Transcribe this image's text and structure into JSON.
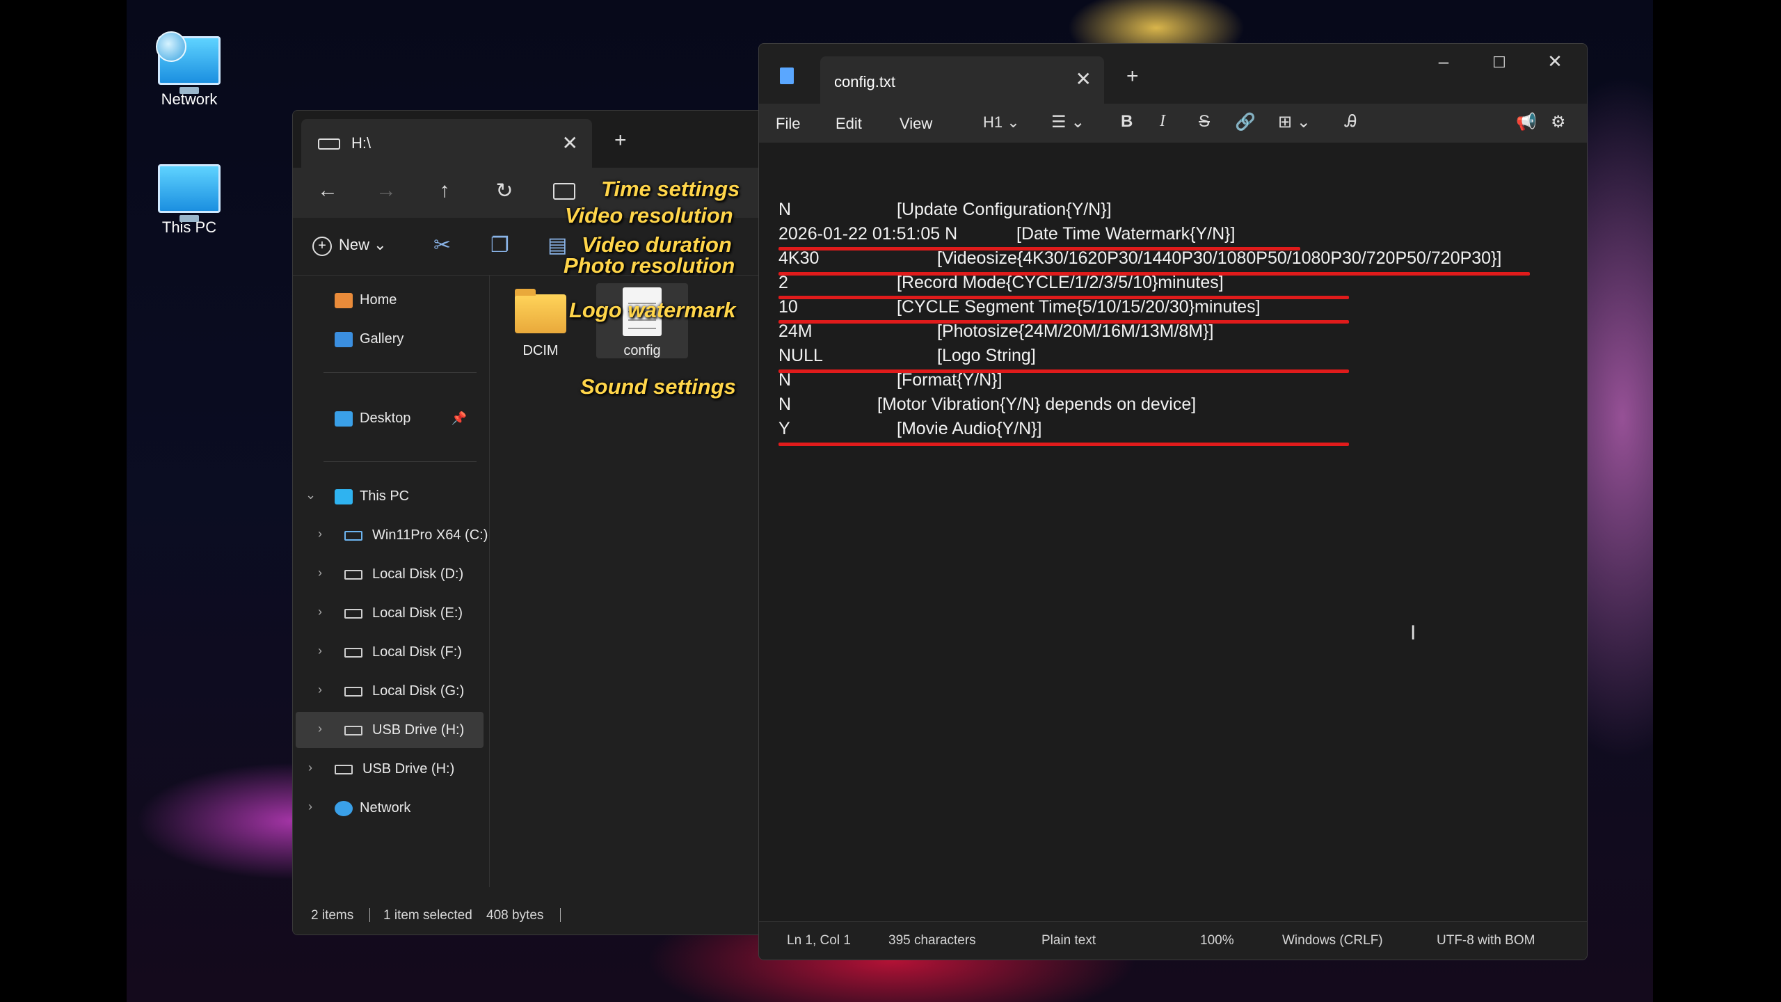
{
  "desktop": {
    "icons": [
      {
        "label": "Network",
        "icon": "network-icon"
      },
      {
        "label": "This PC",
        "icon": "computer-icon"
      }
    ]
  },
  "explorer": {
    "tab_title": "H:\\",
    "tab_close": "✕",
    "new_tab": "+",
    "nav": {
      "back": "←",
      "forward": "→",
      "up": "↑",
      "refresh": "↻"
    },
    "cmd_new_label": "New",
    "sidebar": {
      "home": "Home",
      "gallery": "Gallery",
      "desktop": "Desktop",
      "this_pc": "This PC",
      "drives": [
        "Win11Pro X64 (C:)",
        "Local Disk (D:)",
        "Local Disk (E:)",
        "Local Disk (F:)",
        "Local Disk (G:)",
        "USB Drive (H:)"
      ],
      "usb_root": "USB Drive (H:)",
      "network": "Network"
    },
    "files": [
      {
        "name": "DCIM",
        "type": "folder"
      },
      {
        "name": "config",
        "type": "text-document"
      }
    ],
    "status": {
      "items": "2 items",
      "selected": "1 item selected",
      "size": "408 bytes"
    }
  },
  "notepad": {
    "tab_title": "config.txt",
    "tab_close": "✕",
    "new_tab": "+",
    "window_controls": {
      "minimize": "–",
      "maximize": "☐",
      "close": "✕"
    },
    "menu": {
      "file": "File",
      "edit": "Edit",
      "view": "View"
    },
    "format": {
      "heading": "H1",
      "bold": "B",
      "italic": "I",
      "strike": "S"
    },
    "lines": [
      {
        "value": "N",
        "label": "[Update Configuration{Y/N}]"
      },
      {
        "value": "2026-01-22 01:51:05 N",
        "label": "[Date Time Watermark{Y/N}]"
      },
      {
        "value": "4K30",
        "label": "[Videosize{4K30/1620P30/1440P30/1080P50/1080P30/720P50/720P30}]"
      },
      {
        "value": "2",
        "label": "[Record Mode{CYCLE/1/2/3/5/10}minutes]"
      },
      {
        "value": "10",
        "label": "[CYCLE Segment Time{5/10/15/20/30}minutes]"
      },
      {
        "value": "24M",
        "label": "[Photosize{24M/20M/16M/13M/8M}]"
      },
      {
        "value": "NULL",
        "label": "[Logo String]"
      },
      {
        "value": "N",
        "label": "[Format{Y/N}]"
      },
      {
        "value": "N",
        "label": "[Motor Vibration{Y/N} depends on device]"
      },
      {
        "value": "Y",
        "label": "[Movie Audio{Y/N}]"
      }
    ],
    "status": {
      "position": "Ln 1, Col 1",
      "characters": "395 characters",
      "format": "Plain text",
      "zoom": "100%",
      "line_ending": "Windows (CRLF)",
      "encoding": "UTF-8 with BOM"
    }
  },
  "annotations": {
    "time": "Time settings",
    "video_res": "Video resolution",
    "video_dur": "Video duration",
    "photo_res": "Photo resolution",
    "logo": "Logo watermark",
    "sound": "Sound settings"
  },
  "colors": {
    "annotation": "#ffd54a",
    "underline": "#e01b1b",
    "accent": "#5aa7ff"
  }
}
